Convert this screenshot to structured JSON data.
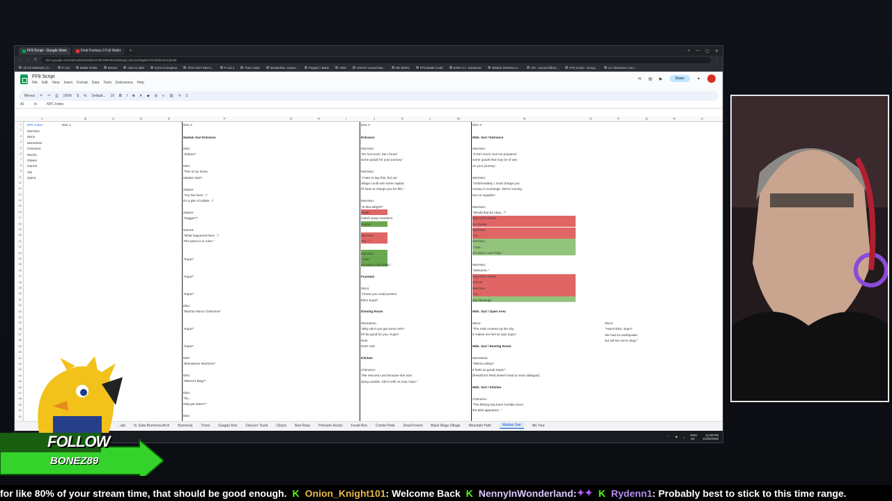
{
  "browser": {
    "tabs": [
      {
        "label": "FF9 Script - Google Shee",
        "active": true
      },
      {
        "label": "Final Fantasy 9 Full Walkt",
        "active": false
      }
    ],
    "new_tab": "+",
    "url": "docs.google.com/spreadsheets/d/1eF38A93NNEX5wbOg3_BuAXed3gZwYDrmh0Ecbc4Q/edit",
    "bookmarks": [
      "All Gil Methods | S...",
      "P List",
      "Battle Fields",
      "Resize",
      "GBJ to 3DS",
      "Echo 0 Dropbox",
      "FFIX OST Eiko's...",
      "P List 2",
      "Pass Vault",
      "MyWarfare, Depar...",
      "Paypal > Bank",
      "AWS",
      "XOFXV Sound Ma...",
      "RE ZERO",
      "FF9 Battle Code",
      "KREA AI - Enhancer",
      "Bibbdo Wireless U...",
      "VIII - Sound Effect...",
      "FF9 Script - Googl...",
      "LG UltraGear Curv..."
    ]
  },
  "sheet": {
    "title": "FF9 Script",
    "menus": [
      "File",
      "Edit",
      "View",
      "Insert",
      "Format",
      "Data",
      "Tools",
      "Extensions",
      "Help"
    ],
    "share_label": "Share",
    "toolbar": {
      "menus": "Menus",
      "zoom": "100%",
      "font": "Default...",
      "size": "10"
    },
    "cell_ref": "A1",
    "formula": "NPC Index",
    "columns": [
      "A",
      "B",
      "C",
      "D",
      "E",
      "F",
      "G",
      "H",
      "I",
      "J",
      "K",
      "L",
      "M",
      "N",
      "O",
      "P",
      "Q",
      "R",
      "S",
      "T"
    ],
    "npc_index": {
      "header": "NPC Index",
      "names": [
        "Morrison",
        "Moco",
        "Mometoso",
        "Chimomo",
        "Mocha",
        "Zidane",
        "Garnet",
        "Vivi",
        "Quina"
      ]
    },
    "disc_headers": [
      "Disc 1",
      "Disc 2",
      "Disc 3",
      "Disc 4"
    ],
    "disc2": [
      "Madain Sari Entrance",
      "Eiko:",
      "\"Zidane!\"",
      "Eiko:",
      "\"This is my home.",
      "Madain Sari!\"",
      "Zidane:",
      "\"You live here...?",
      "It's a pile of rubble...!\"",
      "Zidane:",
      "\"Dagger?\"",
      "Garnet:",
      "\"What happened here...?",
      "This place is in ruins.\"",
      "\"Kupo!\"",
      "\"Kupo!\"",
      "\"Kupo!\"",
      "Eiko:",
      "\"Mocha! Moco! Chimomo!\"",
      "\"Kupo!\"",
      "\"Kupo!\"",
      "Eiko:",
      "\"Momatoso! Morrison!\"",
      "Eiko:",
      "\"Where's Mog?\"",
      "Eiko:",
      "\"No...",
      "Mog got eaten?\"",
      "Eiko:"
    ],
    "disc3": [
      "Entrance",
      "Morrison:",
      "\"It's not much, but I found",
      "some goods for your journey.\"",
      "Morrison:",
      "\"I hate to say this, but our",
      "village could use some capital.",
      "I'll have to charge you for this.\"",
      "Morrison:",
      "\"Is that alright?\"",
      "Trade",
      "Switch party members",
      "Cancel",
      "Morrison:",
      "\"So...\"",
      "Morrison:",
      "\"I see.",
      "I'm sorry I can't help.\"",
      "Fountain",
      "Moco:",
      "\"I knew you could protect",
      "Eiko!  Kupo!\"",
      "Dinning Room",
      "Momatoso:",
      "\"Why don't you get some rest?",
      "It'll be good for you.  Kupo!\"",
      "Rest",
      "Don't rest",
      "Kitchen",
      "Chimomo:",
      "\"We rescued Lani because she was",
      "dying outside.  She's with us now, kupo.\""
    ],
    "disc4": [
      "Mdn. Sari / Entrance",
      "Morrison:",
      "\"It isn't much, but I've prepared",
      "some goods that may be of use",
      "on your journey.\"",
      "Morrison:",
      "\"Unfortunately, I must charge you",
      "money in exchange. We're running",
      "low on supplies.\"",
      "Morrison:",
      "\"Would that be okay...?\"",
      "Pay Gil for items",
      "No thanks",
      "Morrison:",
      "\"So...\"",
      "Morrison:",
      "\"I see.",
      "I'm sorry I can't help.\"",
      "Morrison:",
      "\"Welcome.\"",
      "Pay Gil for items",
      "Cancel",
      "Morrison:",
      "\"So...\"",
      "[No followup]",
      "Mdn. Sari / Open Area",
      "Moco:",
      "\"The mist covered up the sky.",
      "It makes me feel so sad, kupo.\"",
      "Mdn. Sari / Resting Room",
      "Momatoso:",
      "\"Wanna sleep?",
      "It feels so good! Kupo!\"",
      "[Rest/Don't Rest doesn't lead to more dialogue]",
      "Mdn. Sari / Kitchen",
      "Chimomo:",
      "\"The fishing has been horrible since",
      "the Mist appeared...\""
    ],
    "side_note": [
      "Moco:",
      "\"How's Eiko, kupo?",
      "We had an earthquake,",
      "but tell her we're okay.\""
    ],
    "sheet_tabs": [
      "...ate",
      "N. Gate Burmecia Arch",
      "Burmecia",
      "Treno",
      "Gargan Roo",
      "Cleyra's Trunk",
      "Cleyra",
      "Red Rose",
      "Pinnacle Rocks",
      "Fossil Roo",
      "Conde Petie",
      "Dead Forest",
      "Black Mage Village",
      "Mountain Path",
      "Madain Sari",
      "Iifa Tree"
    ],
    "active_sheet": "Madain Sari"
  },
  "taskbar": {
    "lang": "ENG\nUK",
    "time": "11:08 PM",
    "date": "21/05/2026"
  },
  "overlay": {
    "follow": "FOLLOW",
    "channel": "BONEZ89",
    "ticker": [
      {
        "text": "for like 80% of your stream time, that should be good enough.",
        "kind": "msg"
      },
      {
        "text": "Onion_Knight101",
        "kind": "user1"
      },
      {
        "text": ": Welcome Back",
        "kind": "msg"
      },
      {
        "text": "NennyInWonderland",
        "kind": "user2"
      },
      {
        "text": ":",
        "kind": "msg"
      },
      {
        "text": "Rydenn1",
        "kind": "user3"
      },
      {
        "text": ": Probably best to stick to this time range.",
        "kind": "msg"
      }
    ]
  },
  "colors": {
    "accent": "#0f9d58",
    "kick": "#53fc18",
    "red_cell": "#e06666",
    "green_cell": "#6aa84f"
  }
}
